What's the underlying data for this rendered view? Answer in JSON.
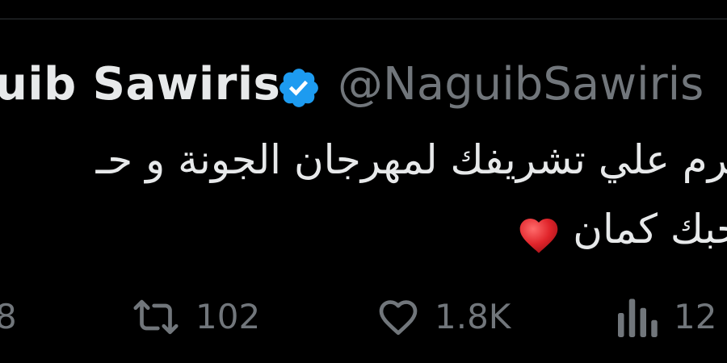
{
  "tweet": {
    "display_name": "uib Sawiris",
    "handle": "@NaguibSawiris",
    "verified": true,
    "text_lines": [
      "ـرم علي تشريفك لمهرجان الجونة و حـ",
      "حبك كمان"
    ],
    "emoji": "red-heart"
  },
  "actions": {
    "replies": "8",
    "retweets": "102",
    "likes": "1.8K",
    "views": "12"
  },
  "colors": {
    "background": "#000000",
    "text": "#e7e9ea",
    "muted": "#71767b",
    "verified_blue": "#1d9bf0",
    "heart_red": "#e0242a"
  }
}
